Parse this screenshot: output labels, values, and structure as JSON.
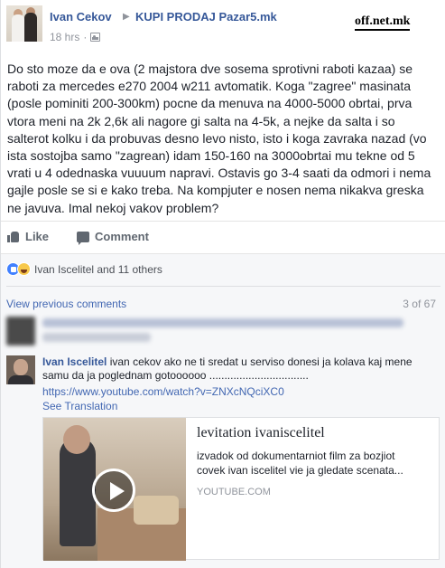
{
  "header": {
    "author": "Ivan Cekov",
    "arrow": "▶",
    "group": "KUPI PRODAJ Pazar5.mk",
    "time": "18 hrs",
    "dot": "·",
    "watermark": "off.net.mk"
  },
  "post": {
    "text": "Do sto moze da e ova (2 majstora dve sosema sprotivni raboti kazaa) se raboti za mercedes e270 2004 w211 avtomatik. Koga \"zagree\" masinata (posle pominiti 200-300km) pocne da menuva na 4000-5000 obrtai, prva vtora meni na 2k 2,6k ali nagore gi salta na 4-5k, a nejke da salta i so salterot kolku i da probuvas desno levo nisto, isto i koga zavraka nazad (vo ista sostojba samo \"zagrean) idam 150-160 na 3000obrtai mu tekne od 5 vrati u 4 odednaska vuuuum napravi. Ostavis go 3-4 saati da odmori i nema gajle posle se si e kako treba. Na kompjuter e nosen nema nikakva greska ne javuva. Imal nekoj vakov problem?"
  },
  "actions": {
    "like": "Like",
    "comment": "Comment"
  },
  "reactions": {
    "text": "Ivan Iscelitel and 11 others"
  },
  "comments": {
    "view_previous": "View previous comments",
    "count": "3 of 67",
    "items": [
      {
        "name": "Ivan Iscelitel",
        "text": "ivan cekov ako ne ti sredat u serviso donesi ja kolava kaj mene samu da ja poglednam gotoooooo .................................",
        "link": "https://www.youtube.com/watch?v=ZNXcNQciXC0",
        "translation": "See Translation"
      }
    ]
  },
  "video": {
    "title": "levitation ivaniscelitel",
    "description": "izvadok od dokumentarniot film za bozjiot covek ivan iscelitel vie ja gledate scenata...",
    "source": "YOUTUBE.COM"
  }
}
